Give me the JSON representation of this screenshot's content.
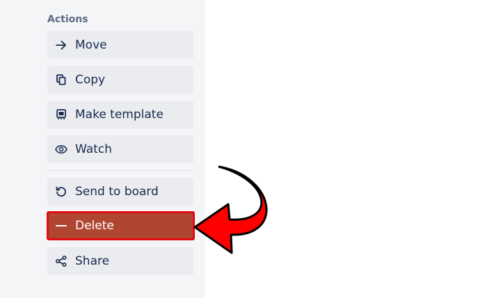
{
  "actions": {
    "title": "Actions",
    "move_label": "Move",
    "copy_label": "Copy",
    "make_template_label": "Make template",
    "watch_label": "Watch",
    "send_to_board_label": "Send to board",
    "delete_label": "Delete",
    "share_label": "Share"
  },
  "icons": {
    "move": "arrow-right-icon",
    "copy": "copy-icon",
    "make_template": "template-icon",
    "watch": "eye-icon",
    "send_to_board": "restore-icon",
    "delete": "minus-icon",
    "share": "share-icon"
  },
  "colors": {
    "panel_bg": "#f4f5f7",
    "button_bg": "#eaecf0",
    "text": "#172b4d",
    "section_title": "#5e6c84",
    "delete_bg": "#b04632",
    "highlight_border": "#e50914",
    "arrow_fill": "#ff0000"
  }
}
